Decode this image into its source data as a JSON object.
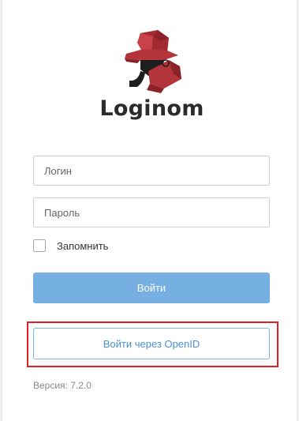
{
  "brand": {
    "name": "Loginom",
    "logo_icon": "detective-mascot-icon"
  },
  "form": {
    "login_placeholder": "Логин",
    "password_placeholder": "Пароль",
    "login_value": "",
    "password_value": "",
    "remember_label": "Запомнить",
    "remember_checked": false,
    "submit_label": "Войти",
    "openid_label": "Войти через OpenID"
  },
  "footer": {
    "version_text": "Версия: 7.2.0"
  },
  "colors": {
    "primary": "#76b0e3",
    "openid_text": "#4a8fd1",
    "highlight": "#e01f26",
    "hat": "#b3343b"
  }
}
